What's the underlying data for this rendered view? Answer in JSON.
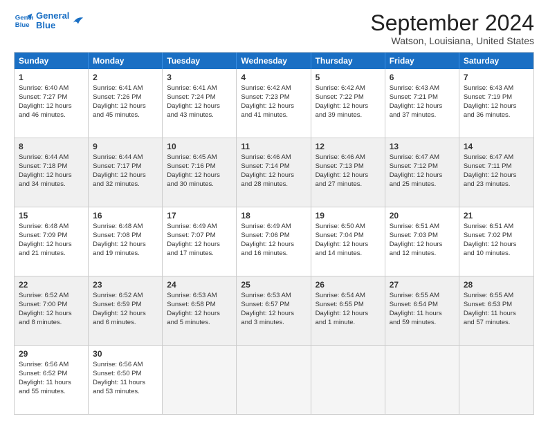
{
  "logo": {
    "line1": "General",
    "line2": "Blue"
  },
  "title": "September 2024",
  "location": "Watson, Louisiana, United States",
  "header_days": [
    "Sunday",
    "Monday",
    "Tuesday",
    "Wednesday",
    "Thursday",
    "Friday",
    "Saturday"
  ],
  "weeks": [
    [
      {
        "day": "1",
        "lines": [
          "Sunrise: 6:40 AM",
          "Sunset: 7:27 PM",
          "Daylight: 12 hours",
          "and 46 minutes."
        ]
      },
      {
        "day": "2",
        "lines": [
          "Sunrise: 6:41 AM",
          "Sunset: 7:26 PM",
          "Daylight: 12 hours",
          "and 45 minutes."
        ]
      },
      {
        "day": "3",
        "lines": [
          "Sunrise: 6:41 AM",
          "Sunset: 7:24 PM",
          "Daylight: 12 hours",
          "and 43 minutes."
        ]
      },
      {
        "day": "4",
        "lines": [
          "Sunrise: 6:42 AM",
          "Sunset: 7:23 PM",
          "Daylight: 12 hours",
          "and 41 minutes."
        ]
      },
      {
        "day": "5",
        "lines": [
          "Sunrise: 6:42 AM",
          "Sunset: 7:22 PM",
          "Daylight: 12 hours",
          "and 39 minutes."
        ]
      },
      {
        "day": "6",
        "lines": [
          "Sunrise: 6:43 AM",
          "Sunset: 7:21 PM",
          "Daylight: 12 hours",
          "and 37 minutes."
        ]
      },
      {
        "day": "7",
        "lines": [
          "Sunrise: 6:43 AM",
          "Sunset: 7:19 PM",
          "Daylight: 12 hours",
          "and 36 minutes."
        ]
      }
    ],
    [
      {
        "day": "8",
        "lines": [
          "Sunrise: 6:44 AM",
          "Sunset: 7:18 PM",
          "Daylight: 12 hours",
          "and 34 minutes."
        ]
      },
      {
        "day": "9",
        "lines": [
          "Sunrise: 6:44 AM",
          "Sunset: 7:17 PM",
          "Daylight: 12 hours",
          "and 32 minutes."
        ]
      },
      {
        "day": "10",
        "lines": [
          "Sunrise: 6:45 AM",
          "Sunset: 7:16 PM",
          "Daylight: 12 hours",
          "and 30 minutes."
        ]
      },
      {
        "day": "11",
        "lines": [
          "Sunrise: 6:46 AM",
          "Sunset: 7:14 PM",
          "Daylight: 12 hours",
          "and 28 minutes."
        ]
      },
      {
        "day": "12",
        "lines": [
          "Sunrise: 6:46 AM",
          "Sunset: 7:13 PM",
          "Daylight: 12 hours",
          "and 27 minutes."
        ]
      },
      {
        "day": "13",
        "lines": [
          "Sunrise: 6:47 AM",
          "Sunset: 7:12 PM",
          "Daylight: 12 hours",
          "and 25 minutes."
        ]
      },
      {
        "day": "14",
        "lines": [
          "Sunrise: 6:47 AM",
          "Sunset: 7:11 PM",
          "Daylight: 12 hours",
          "and 23 minutes."
        ]
      }
    ],
    [
      {
        "day": "15",
        "lines": [
          "Sunrise: 6:48 AM",
          "Sunset: 7:09 PM",
          "Daylight: 12 hours",
          "and 21 minutes."
        ]
      },
      {
        "day": "16",
        "lines": [
          "Sunrise: 6:48 AM",
          "Sunset: 7:08 PM",
          "Daylight: 12 hours",
          "and 19 minutes."
        ]
      },
      {
        "day": "17",
        "lines": [
          "Sunrise: 6:49 AM",
          "Sunset: 7:07 PM",
          "Daylight: 12 hours",
          "and 17 minutes."
        ]
      },
      {
        "day": "18",
        "lines": [
          "Sunrise: 6:49 AM",
          "Sunset: 7:06 PM",
          "Daylight: 12 hours",
          "and 16 minutes."
        ]
      },
      {
        "day": "19",
        "lines": [
          "Sunrise: 6:50 AM",
          "Sunset: 7:04 PM",
          "Daylight: 12 hours",
          "and 14 minutes."
        ]
      },
      {
        "day": "20",
        "lines": [
          "Sunrise: 6:51 AM",
          "Sunset: 7:03 PM",
          "Daylight: 12 hours",
          "and 12 minutes."
        ]
      },
      {
        "day": "21",
        "lines": [
          "Sunrise: 6:51 AM",
          "Sunset: 7:02 PM",
          "Daylight: 12 hours",
          "and 10 minutes."
        ]
      }
    ],
    [
      {
        "day": "22",
        "lines": [
          "Sunrise: 6:52 AM",
          "Sunset: 7:00 PM",
          "Daylight: 12 hours",
          "and 8 minutes."
        ]
      },
      {
        "day": "23",
        "lines": [
          "Sunrise: 6:52 AM",
          "Sunset: 6:59 PM",
          "Daylight: 12 hours",
          "and 6 minutes."
        ]
      },
      {
        "day": "24",
        "lines": [
          "Sunrise: 6:53 AM",
          "Sunset: 6:58 PM",
          "Daylight: 12 hours",
          "and 5 minutes."
        ]
      },
      {
        "day": "25",
        "lines": [
          "Sunrise: 6:53 AM",
          "Sunset: 6:57 PM",
          "Daylight: 12 hours",
          "and 3 minutes."
        ]
      },
      {
        "day": "26",
        "lines": [
          "Sunrise: 6:54 AM",
          "Sunset: 6:55 PM",
          "Daylight: 12 hours",
          "and 1 minute."
        ]
      },
      {
        "day": "27",
        "lines": [
          "Sunrise: 6:55 AM",
          "Sunset: 6:54 PM",
          "Daylight: 11 hours",
          "and 59 minutes."
        ]
      },
      {
        "day": "28",
        "lines": [
          "Sunrise: 6:55 AM",
          "Sunset: 6:53 PM",
          "Daylight: 11 hours",
          "and 57 minutes."
        ]
      }
    ],
    [
      {
        "day": "29",
        "lines": [
          "Sunrise: 6:56 AM",
          "Sunset: 6:52 PM",
          "Daylight: 11 hours",
          "and 55 minutes."
        ]
      },
      {
        "day": "30",
        "lines": [
          "Sunrise: 6:56 AM",
          "Sunset: 6:50 PM",
          "Daylight: 11 hours",
          "and 53 minutes."
        ]
      },
      {
        "day": "",
        "lines": [],
        "empty": true
      },
      {
        "day": "",
        "lines": [],
        "empty": true
      },
      {
        "day": "",
        "lines": [],
        "empty": true
      },
      {
        "day": "",
        "lines": [],
        "empty": true
      },
      {
        "day": "",
        "lines": [],
        "empty": true
      }
    ]
  ]
}
